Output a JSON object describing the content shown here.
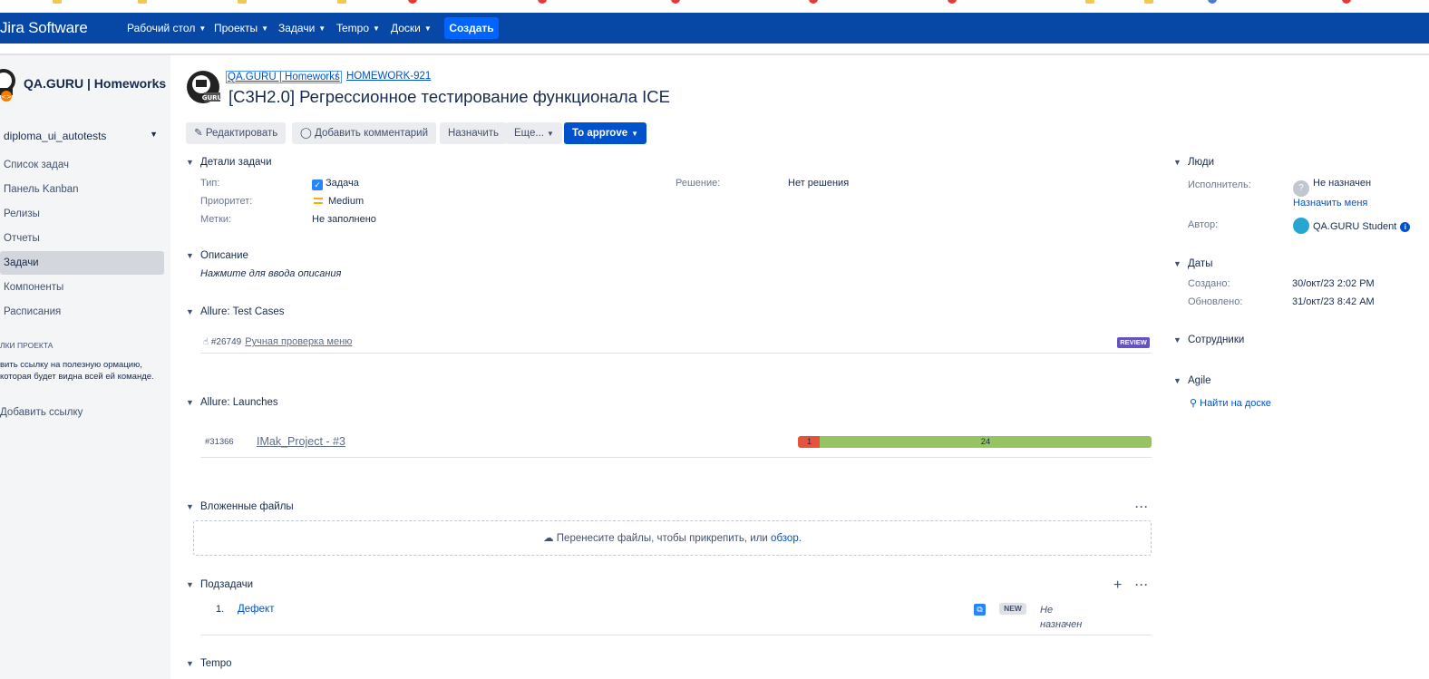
{
  "colors": {
    "topbar": "#0747a6",
    "create": "#0065ff",
    "primary_button": "#0052cc",
    "link": "#0052cc",
    "fail": "#e5533d",
    "pass": "#97c463",
    "review": "#6554c0"
  },
  "app": {
    "logo": "Jira Software"
  },
  "topnav": {
    "items": [
      {
        "label": "Рабочий стол"
      },
      {
        "label": "Проекты"
      },
      {
        "label": "Задачи"
      },
      {
        "label": "Tempo"
      },
      {
        "label": "Доски"
      }
    ],
    "create_label": "Создать"
  },
  "sidebar": {
    "project_name": "QA.GURU | Homeworks",
    "board": "diploma_ui_autotests",
    "items": [
      {
        "label": "Список задач"
      },
      {
        "label": "Панель Kanban"
      },
      {
        "label": "Релизы"
      },
      {
        "label": "Отчеты"
      },
      {
        "label": "Задачи"
      },
      {
        "label": "Компоненты"
      },
      {
        "label": "Расписания"
      }
    ],
    "shortcuts_title": "лки проекта",
    "shortcuts_desc": "вить ссылку на полезную ормацию, которая будет видна всей ей команде.",
    "add_link": "Добавить ссылку"
  },
  "issue": {
    "breadcrumb_project": "QA.GURU | Homeworks",
    "breadcrumb_sep": "/",
    "breadcrumb_key": "HOMEWORK-921",
    "title": "[C3H2.0] Регрессионное тестирование функционала ICE"
  },
  "toolbar": {
    "edit": "Редактировать",
    "comment": "Добавить комментарий",
    "assign": "Назначить",
    "more": "Еще...",
    "workflow": "To approve"
  },
  "details": {
    "heading": "Детали задачи",
    "type_label": "Тип:",
    "type_value": "Задача",
    "priority_label": "Приоритет:",
    "priority_value": "Medium",
    "labels_label": "Метки:",
    "labels_value": "Не заполнено",
    "resolution_label": "Решение:",
    "resolution_value": "Нет решения"
  },
  "description": {
    "heading": "Описание",
    "placeholder": "Нажмите для ввода описания"
  },
  "test_cases": {
    "heading": "Allure: Test Cases",
    "id": "#26749",
    "name": "Ручная проверка меню",
    "status": "REVIEW"
  },
  "launches": {
    "heading": "Allure: Launches",
    "id": "#31366",
    "name": "IMak_Project - #3",
    "failed": "1",
    "passed": "24"
  },
  "attachments": {
    "heading": "Вложенные файлы",
    "drop_text": "Перенесите файлы, чтобы прикрепить, или",
    "browse": "обзор."
  },
  "subtasks": {
    "heading": "Подзадачи",
    "num": "1.",
    "name": "Дефект",
    "status": "NEW",
    "assignee": "Не назначен"
  },
  "tempo": {
    "heading": "Tempo"
  },
  "people": {
    "heading": "Люди",
    "assignee_label": "Исполнитель:",
    "assignee_value": "Не назначен",
    "assign_me": "Назначить меня",
    "reporter_label": "Автор:",
    "reporter_value": "QA.GURU Student"
  },
  "dates": {
    "heading": "Даты",
    "created_label": "Создано:",
    "created_value": "30/окт/23 2:02 PM",
    "updated_label": "Обновлено:",
    "updated_value": "31/окт/23 8:42 AM"
  },
  "employees": {
    "heading": "Сотрудники"
  },
  "agile": {
    "heading": "Agile",
    "find_board": "Найти на доске"
  }
}
